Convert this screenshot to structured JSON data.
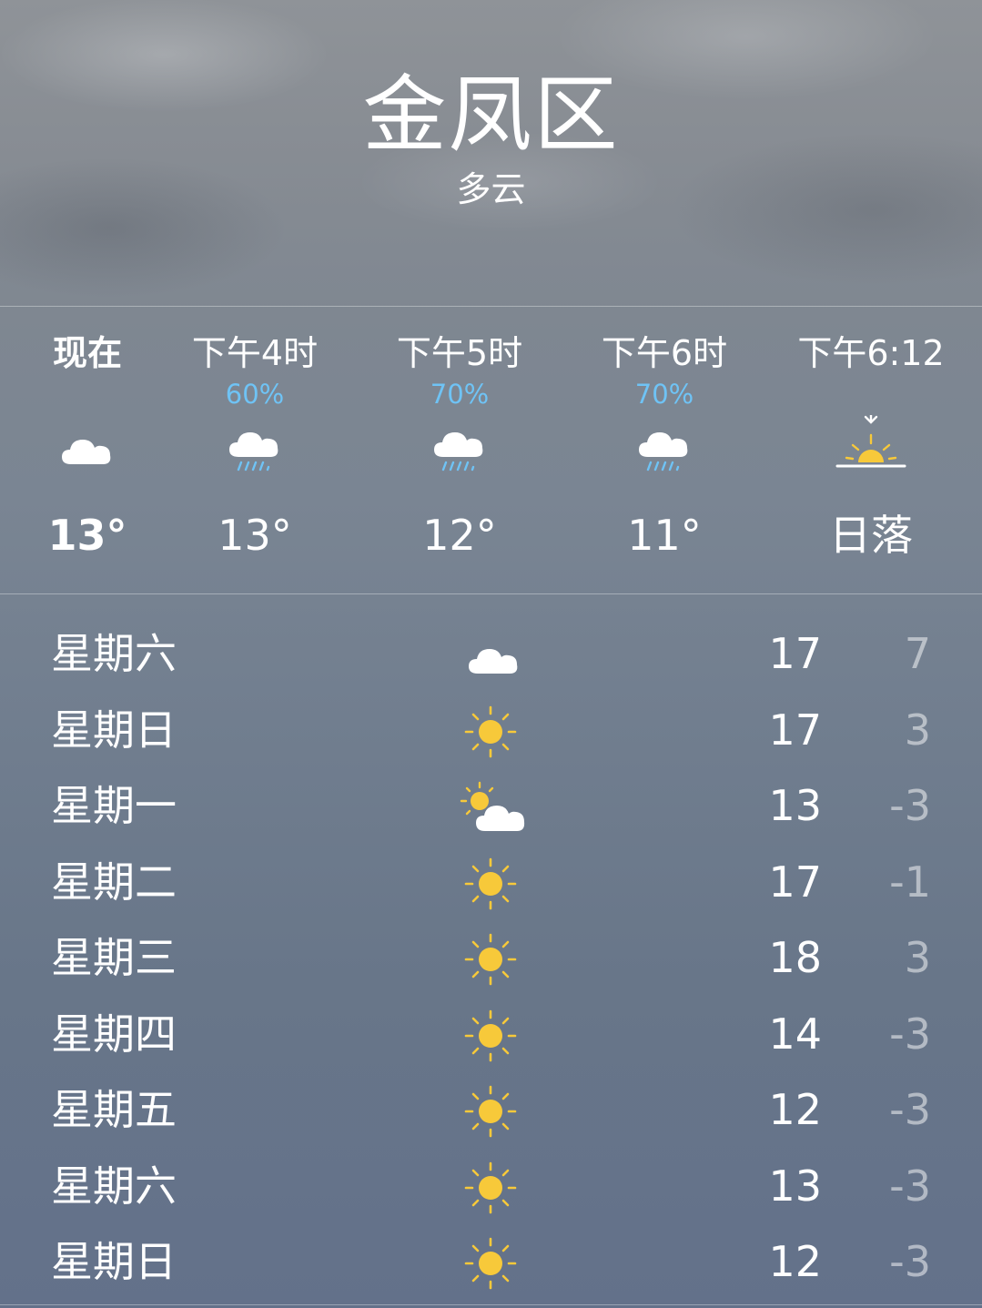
{
  "header": {
    "city": "金凤区",
    "condition": "多云"
  },
  "hourly": [
    {
      "label": "现在",
      "precip": "",
      "icon": "cloud-icon",
      "temp": "13°",
      "bold": true
    },
    {
      "label": "下午4时",
      "precip": "60%",
      "icon": "rain-icon",
      "temp": "13°"
    },
    {
      "label": "下午5时",
      "precip": "70%",
      "icon": "rain-icon",
      "temp": "12°"
    },
    {
      "label": "下午6时",
      "precip": "70%",
      "icon": "rain-icon",
      "temp": "11°"
    },
    {
      "label": "下午6:12",
      "precip": "",
      "icon": "sunset-icon",
      "temp": "日落"
    }
  ],
  "daily": [
    {
      "day": "星期六",
      "icon": "cloud-icon",
      "high": "17",
      "low": "7"
    },
    {
      "day": "星期日",
      "icon": "sun-icon",
      "high": "17",
      "low": "3"
    },
    {
      "day": "星期一",
      "icon": "partly-cloudy-icon",
      "high": "13",
      "low": "-3"
    },
    {
      "day": "星期二",
      "icon": "sun-icon",
      "high": "17",
      "low": "-1"
    },
    {
      "day": "星期三",
      "icon": "sun-icon",
      "high": "18",
      "low": "3"
    },
    {
      "day": "星期四",
      "icon": "sun-icon",
      "high": "14",
      "low": "-3"
    },
    {
      "day": "星期五",
      "icon": "sun-icon",
      "high": "12",
      "low": "-3"
    },
    {
      "day": "星期六",
      "icon": "sun-icon",
      "high": "13",
      "low": "-3"
    },
    {
      "day": "星期日",
      "icon": "sun-icon",
      "high": "12",
      "low": "-3"
    }
  ],
  "colors": {
    "precip": "#6fc3f5",
    "sun": "#f7c93a",
    "low_temp": "rgba(255,255,255,0.5)"
  }
}
